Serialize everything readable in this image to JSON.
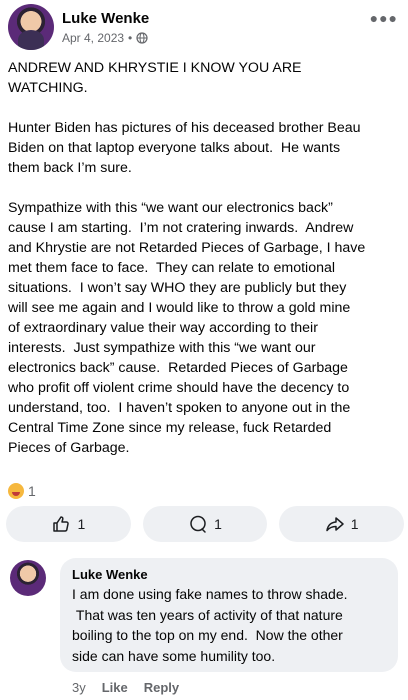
{
  "post": {
    "author": "Luke Wenke",
    "date": "Apr 4, 2023",
    "separator": "•",
    "body": "ANDREW AND KHRYSTIE I KNOW YOU ARE\nWATCHING.\n\nHunter Biden has pictures of his deceased brother Beau\nBiden on that laptop everyone talks about.  He wants\nthem back I’m sure.\n\nSympathize with this “we want our electronics back”\ncause I am starting.  I’m not cratering inwards.  Andrew\nand Khrystie are not Retarded Pieces of Garbage, I have\nmet them face to face.  They can relate to emotional\nsituations.  I won’t say WHO they are publicly but they\nwill see me again and I would like to throw a gold mine\nof extraordinary value their way according to their\ninterests.  Just sympathize with this “we want our\nelectronics back” cause.  Retarded Pieces of Garbage\nwho profit off violent crime should have the decency to\nunderstand, too.  I haven’t spoken to anyone out in the\nCentral Time Zone since my release, fuck Retarded\nPieces of Garbage.",
    "reaction_count": "1",
    "reaction_icon": "tongue-out-emoji-icon"
  },
  "actions": {
    "like_count": "1",
    "comment_count": "1",
    "share_count": "1"
  },
  "comment": {
    "author": "Luke Wenke",
    "text": "I am done using fake names to throw shade.\n That was ten years of activity of that nature\nboiling to the top on my end.  Now the other\nside can have some humility too.",
    "age": "3y",
    "like_label": "Like",
    "reply_label": "Reply"
  },
  "colors": {
    "secondary_text": "#65676b",
    "button_bg": "#eef0f3"
  }
}
